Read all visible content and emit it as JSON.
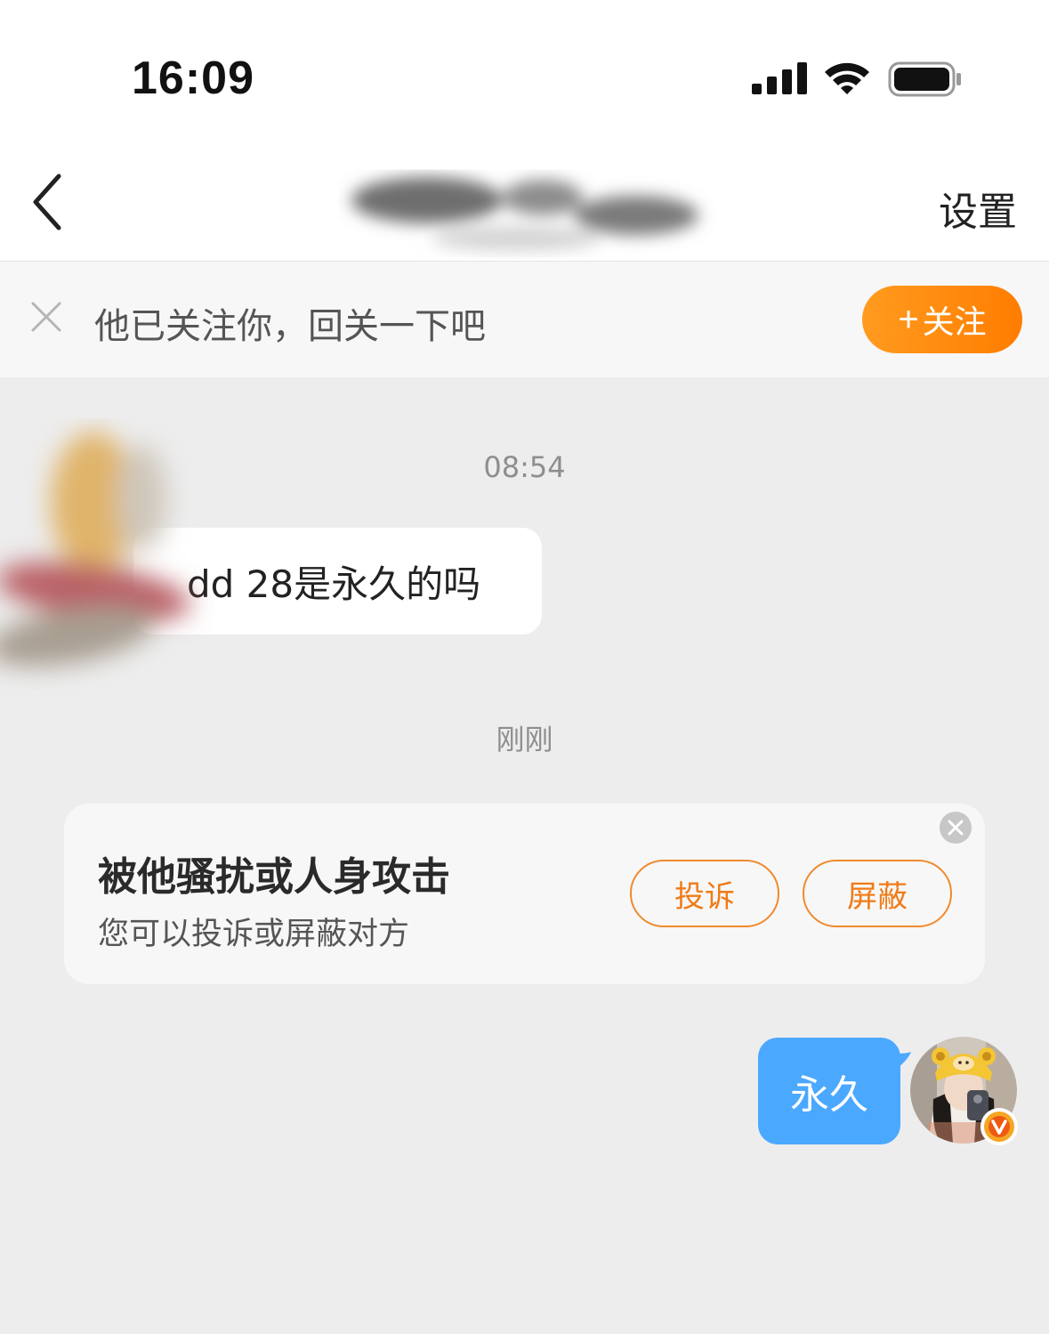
{
  "status_bar": {
    "time": "16:09"
  },
  "nav": {
    "back_icon": "chevron-left-icon",
    "settings_label": "设置"
  },
  "follow_banner": {
    "text": "他已关注你，回关一下吧",
    "button_label": "关注",
    "button_plus": "+",
    "accent_color": "#ff8a0d"
  },
  "chat": {
    "timestamp_1": "08:54",
    "incoming_message": "dd 28是永久的吗",
    "timestamp_2": "刚刚",
    "outgoing_message": "永久",
    "outgoing_color": "#4ba8ff"
  },
  "safety_card": {
    "title": "被他骚扰或人身攻击",
    "subtitle": "您可以投诉或屏蔽对方",
    "report_label": "投诉",
    "block_label": "屏蔽",
    "button_color": "#f07b17"
  }
}
